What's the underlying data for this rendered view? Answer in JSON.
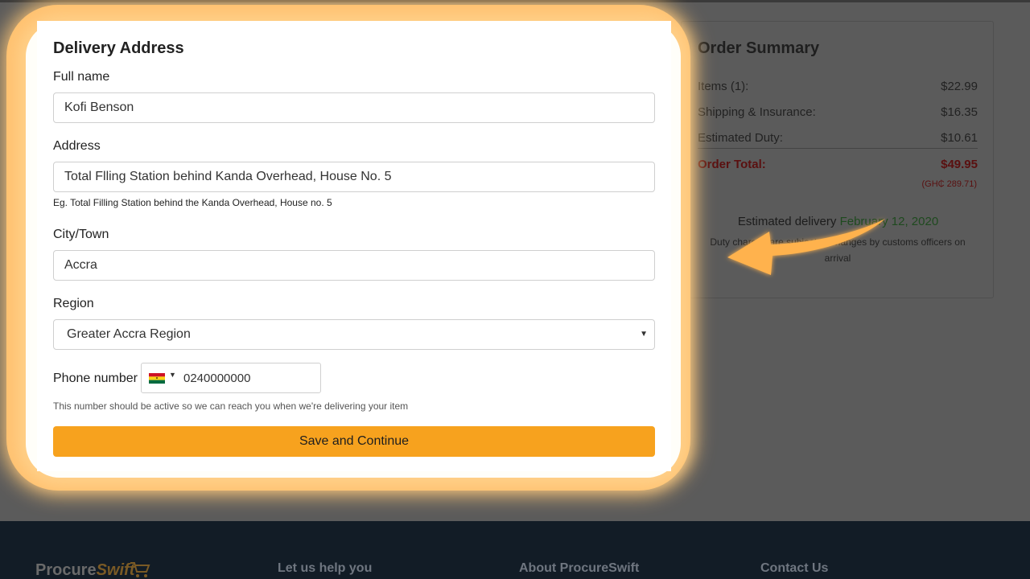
{
  "form": {
    "title": "Delivery Address",
    "full_name_label": "Full name",
    "full_name_value": "Kofi Benson",
    "address_label": "Address",
    "address_value": "Total Flling Station behind Kanda Overhead, House No. 5",
    "address_help": "Eg. Total Filling Station behind the Kanda Overhead, House no. 5",
    "city_label": "City/Town",
    "city_value": "Accra",
    "region_label": "Region",
    "region_value": "Greater Accra Region",
    "phone_label": "Phone number",
    "phone_value": "0240000000",
    "phone_help": "This number should be active so we can reach you when we're delivering your item",
    "save_label": "Save and Continue"
  },
  "summary": {
    "title": "Order Summary",
    "items_label": "Items (1):",
    "items_value": "$22.99",
    "shipping_label": "Shipping & Insurance:",
    "shipping_value": "$16.35",
    "duty_label": "Estimated Duty:",
    "duty_value": "$10.61",
    "total_label": "Order Total:",
    "total_value": "$49.95",
    "total_ghs": "(GH₵ 289.71)",
    "est_prefix": "Estimated delivery",
    "est_date": "February 12, 2020",
    "duty_note": "Duty charges are subject to changes by customs officers on arrival"
  },
  "footer": {
    "logo_a": "Procure",
    "logo_b": "Swift",
    "col1": "Let us help you",
    "col2": "About ProcureSwift",
    "col3": "Contact Us"
  },
  "colors": {
    "accent": "#f7a21e",
    "highlight": "#ffc271",
    "footer_bg": "#121c26"
  },
  "icons": [
    "ghana-flag-icon",
    "caret-down-icon",
    "arrow-pointer-icon",
    "cart-icon"
  ]
}
